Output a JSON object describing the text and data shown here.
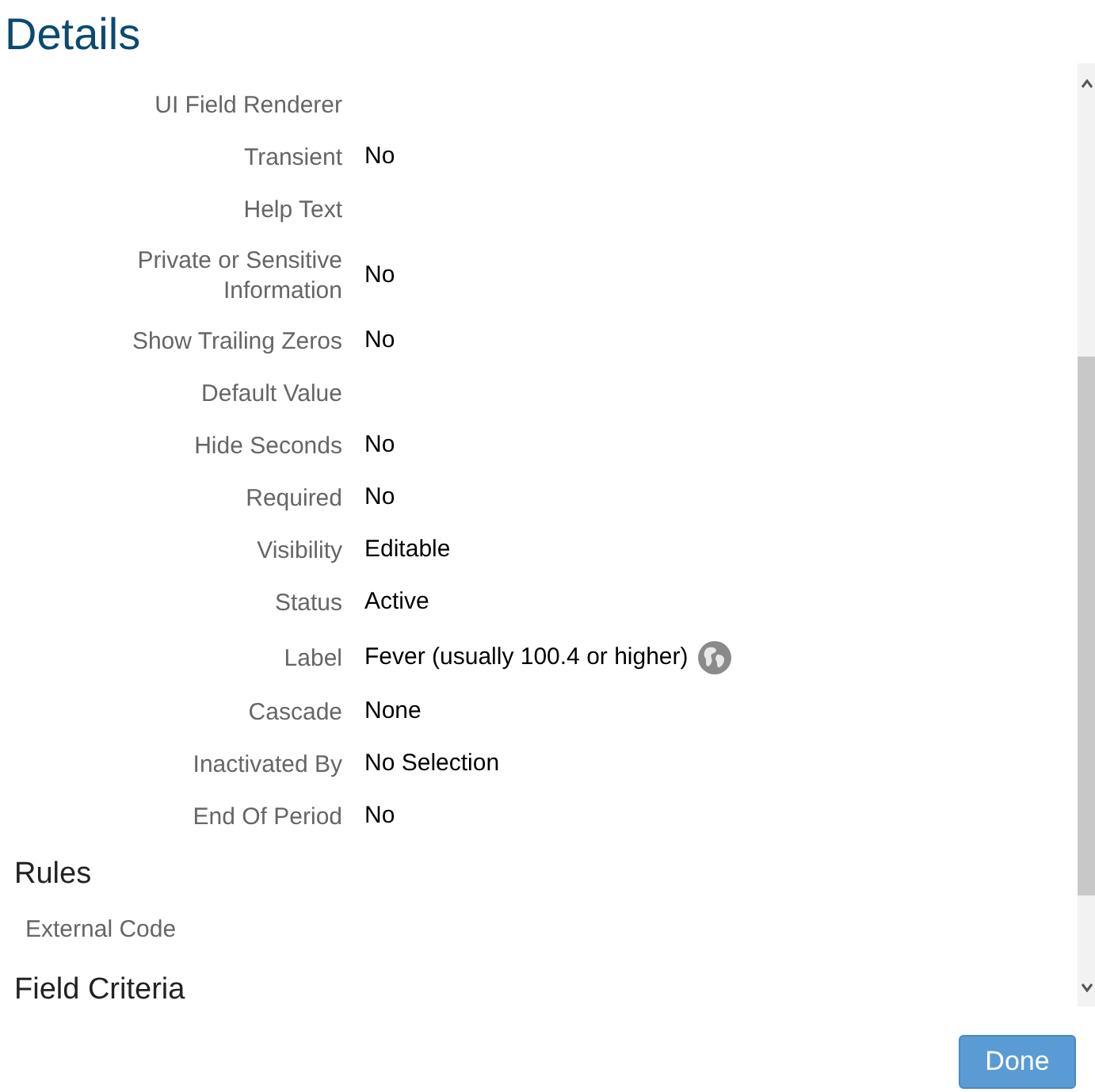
{
  "title": "Details",
  "fields": [
    {
      "label": "UI Field Renderer"
    },
    {
      "label": "Transient",
      "value": "No"
    },
    {
      "label": "Help Text"
    },
    {
      "label": "Private or Sensitive Information",
      "value": "No"
    },
    {
      "label": "Show Trailing Zeros",
      "value": "No"
    },
    {
      "label": "Default Value"
    },
    {
      "label": "Hide Seconds",
      "value": "No"
    },
    {
      "label": "Required",
      "value": "No"
    },
    {
      "label": "Visibility",
      "value": "Editable"
    },
    {
      "label": "Status",
      "value": "Active"
    },
    {
      "label": "Label",
      "value": "Fever (usually 100.4 or higher)",
      "translations": true
    },
    {
      "label": "Cascade",
      "value": "None"
    },
    {
      "label": "Inactivated By",
      "value": "No Selection"
    },
    {
      "label": "End Of Period",
      "value": "No"
    }
  ],
  "sections": [
    {
      "title": "Rules",
      "items": [
        "External Code"
      ]
    },
    {
      "title": "Field Criteria"
    }
  ],
  "done_button": "Done"
}
